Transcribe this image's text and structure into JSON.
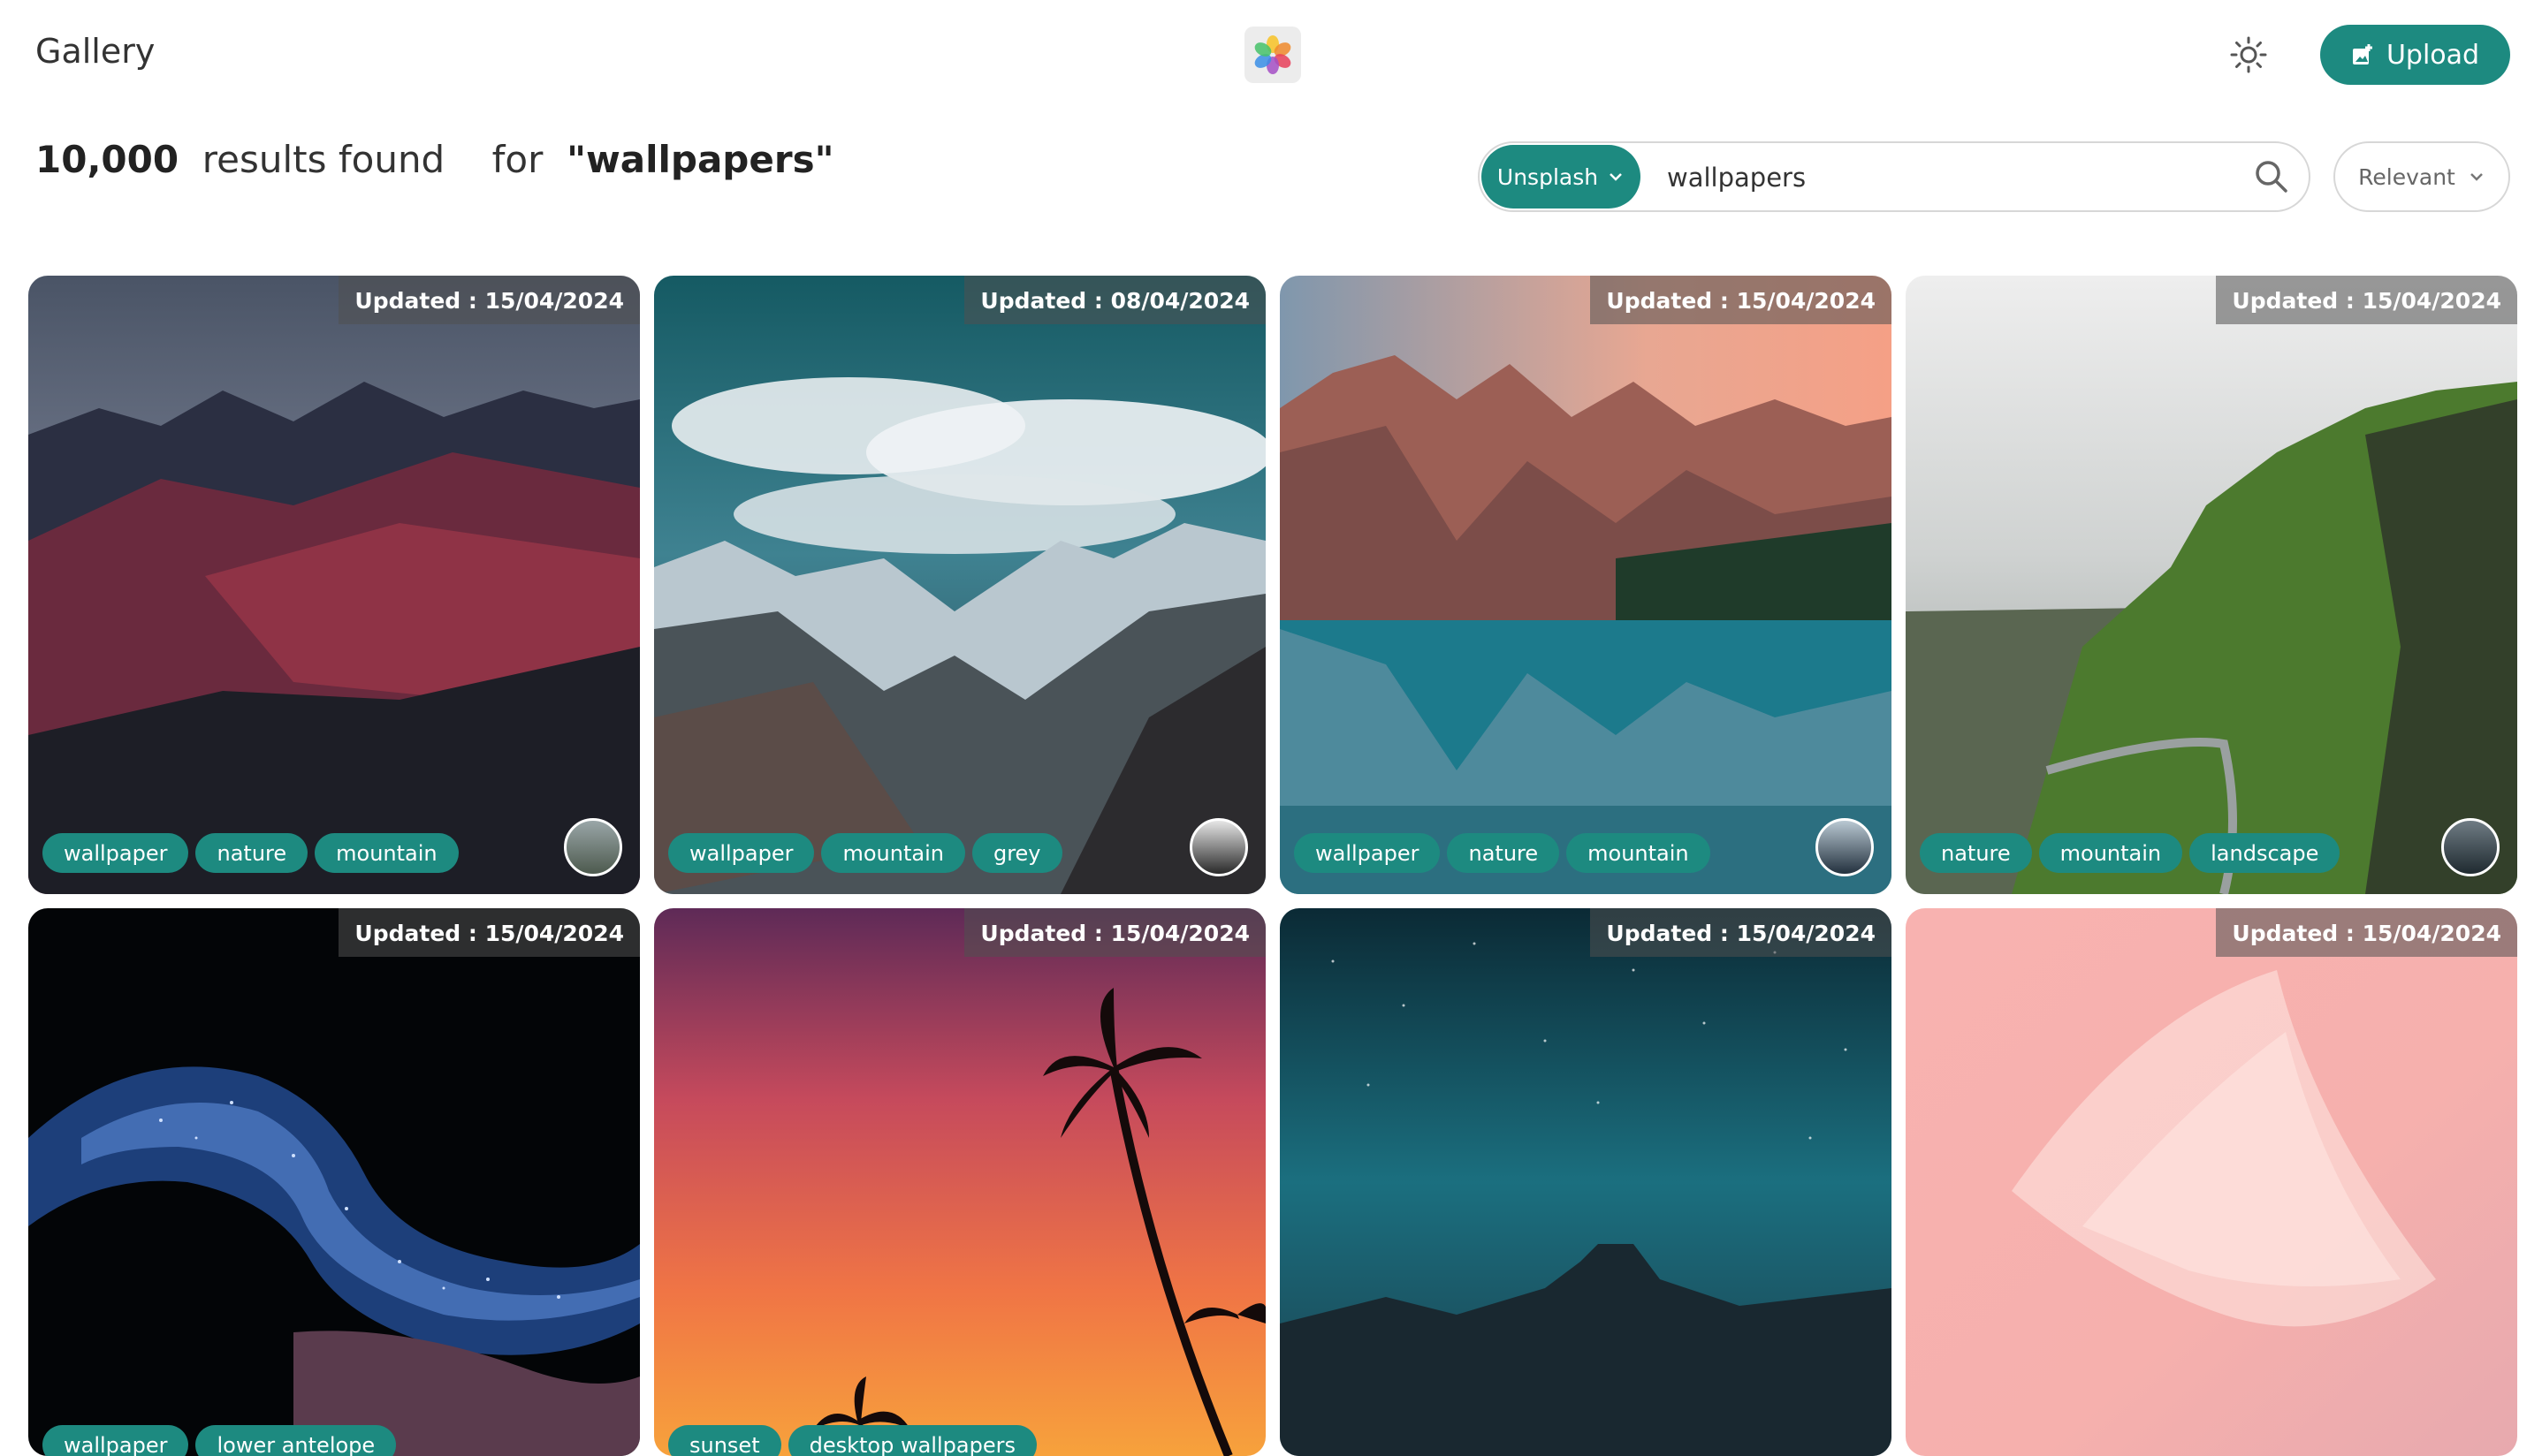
{
  "header": {
    "app_title": "Gallery",
    "logo_icon": "flower-logo-icon",
    "theme_icon": "sun-icon",
    "upload_label": "Upload",
    "upload_icon": "image-add-icon"
  },
  "results": {
    "count": "10,000",
    "found_text": "results found",
    "for_text": "for",
    "query_display": "\"wallpapers\""
  },
  "search": {
    "source_label": "Unsplash",
    "value": "wallpapers",
    "sort_label": "Relevant"
  },
  "cards": [
    {
      "date": "Updated : 15/04/2024",
      "tags": [
        "wallpaper",
        "nature",
        "mountain"
      ],
      "avatar": true
    },
    {
      "date": "Updated : 08/04/2024",
      "tags": [
        "wallpaper",
        "mountain",
        "grey"
      ],
      "avatar": true
    },
    {
      "date": "Updated : 15/04/2024",
      "tags": [
        "wallpaper",
        "nature",
        "mountain"
      ],
      "avatar": true
    },
    {
      "date": "Updated : 15/04/2024",
      "tags": [
        "nature",
        "mountain",
        "landscape"
      ],
      "avatar": true
    },
    {
      "date": "Updated : 15/04/2024",
      "tags": [
        "wallpaper",
        "lower antelope"
      ],
      "avatar": false
    },
    {
      "date": "Updated : 15/04/2024",
      "tags": [
        "sunset",
        "desktop wallpapers"
      ],
      "avatar": false
    },
    {
      "date": "Updated : 15/04/2024",
      "tags": [],
      "avatar": false
    },
    {
      "date": "Updated : 15/04/2024",
      "tags": [],
      "avatar": false
    }
  ],
  "colors": {
    "accent": "#1d8a80"
  }
}
